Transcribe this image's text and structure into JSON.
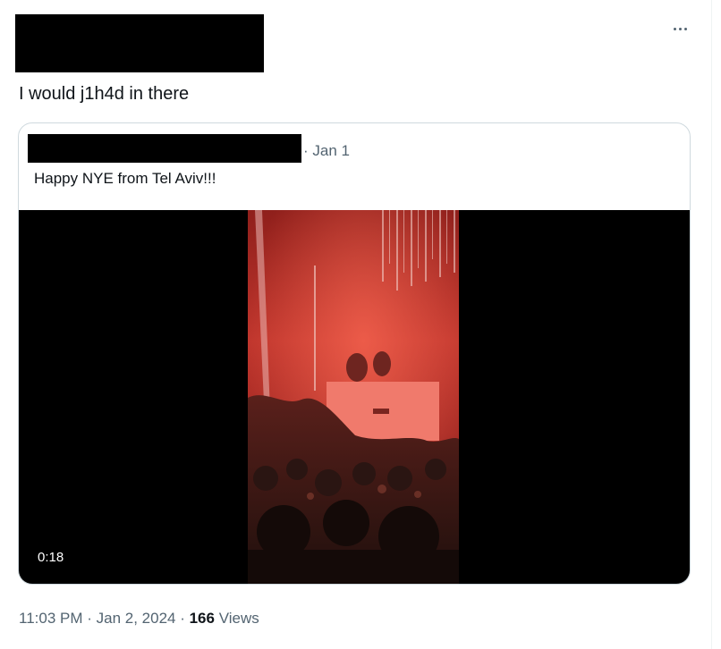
{
  "tweet": {
    "text": "I would j1h4d in there",
    "more_icon": "more-horizontal-icon"
  },
  "quote": {
    "date": "· Jan 1",
    "text": "Happy NYE from Tel Aviv!!!",
    "video": {
      "duration": "0:18"
    }
  },
  "meta": {
    "time": "11:03 PM",
    "separator_1": " · ",
    "date": "Jan 2, 2024",
    "separator_2": " · ",
    "views_count": "166",
    "views_label": " Views"
  },
  "colors": {
    "text_primary": "#0f1419",
    "text_secondary": "#536471",
    "border": "#cfd9de",
    "video_tint": "#c0302a"
  }
}
